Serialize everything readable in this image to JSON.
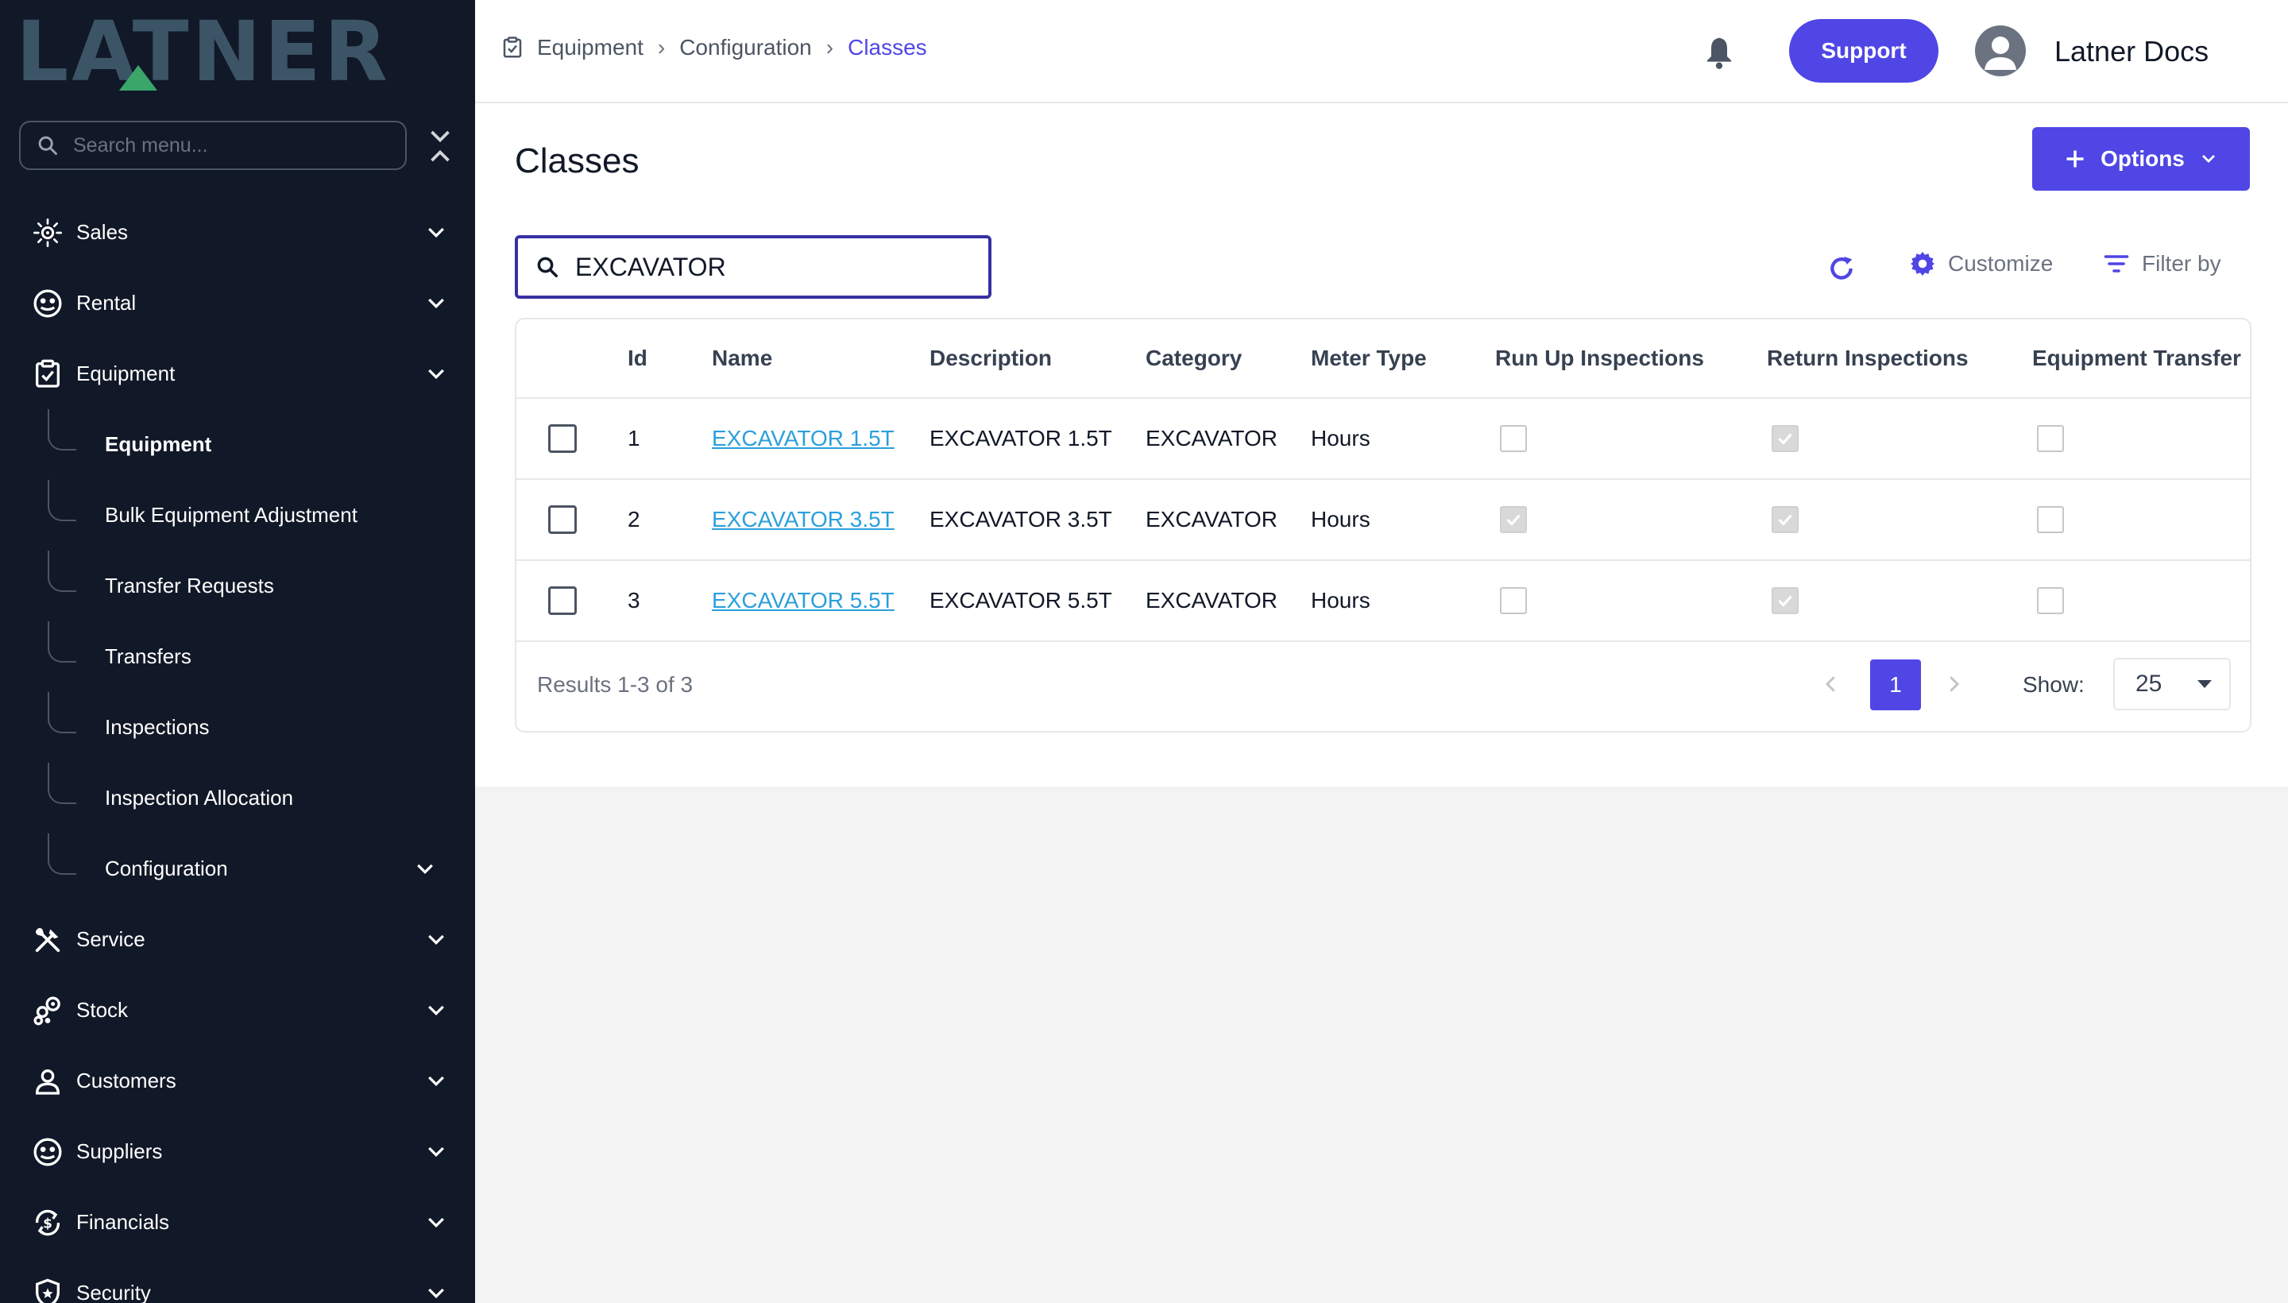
{
  "brand": {
    "logo_text": "LATNER"
  },
  "sidebar": {
    "search_placeholder": "Search menu...",
    "items": [
      {
        "label": "Sales",
        "icon": "sales-icon"
      },
      {
        "label": "Rental",
        "icon": "rental-icon"
      },
      {
        "label": "Equipment",
        "icon": "equipment-icon"
      },
      {
        "label": "Service",
        "icon": "service-icon"
      },
      {
        "label": "Stock",
        "icon": "stock-icon"
      },
      {
        "label": "Customers",
        "icon": "customers-icon"
      },
      {
        "label": "Suppliers",
        "icon": "suppliers-icon"
      },
      {
        "label": "Financials",
        "icon": "financials-icon"
      },
      {
        "label": "Security",
        "icon": "security-icon"
      }
    ],
    "equipment_sub": [
      "Equipment",
      "Bulk Equipment Adjustment",
      "Transfer Requests",
      "Transfers",
      "Inspections",
      "Inspection Allocation",
      "Configuration"
    ]
  },
  "header": {
    "breadcrumb": [
      "Equipment",
      "Configuration",
      "Classes"
    ],
    "support_label": "Support",
    "user_name": "Latner Docs"
  },
  "page": {
    "title": "Classes",
    "options_label": "Options",
    "search_value": "EXCAVATOR",
    "customize_label": "Customize",
    "filter_label": "Filter by"
  },
  "table": {
    "columns": [
      "Id",
      "Name",
      "Description",
      "Category",
      "Meter Type",
      "Run Up Inspections",
      "Return Inspections",
      "Equipment Transfer"
    ],
    "rows": [
      {
        "id": "1",
        "name": "EXCAVATOR 1.5T",
        "description": "EXCAVATOR 1.5T",
        "category": "EXCAVATOR",
        "meter_type": "Hours",
        "run_up": false,
        "return": true,
        "transfer": false
      },
      {
        "id": "2",
        "name": "EXCAVATOR 3.5T",
        "description": "EXCAVATOR 3.5T",
        "category": "EXCAVATOR",
        "meter_type": "Hours",
        "run_up": true,
        "return": true,
        "transfer": false
      },
      {
        "id": "3",
        "name": "EXCAVATOR 5.5T",
        "description": "EXCAVATOR 5.5T",
        "category": "EXCAVATOR",
        "meter_type": "Hours",
        "run_up": false,
        "return": true,
        "transfer": false
      }
    ],
    "results_text": "Results 1-3 of 3",
    "current_page": "1",
    "show_label": "Show:",
    "page_size": "25"
  },
  "colors": {
    "sidebar_bg": "#111827",
    "accent": "#4f46e5",
    "link": "#2b9fdc",
    "logo": "#3c5566",
    "logo_triangle": "#3aa66a"
  }
}
